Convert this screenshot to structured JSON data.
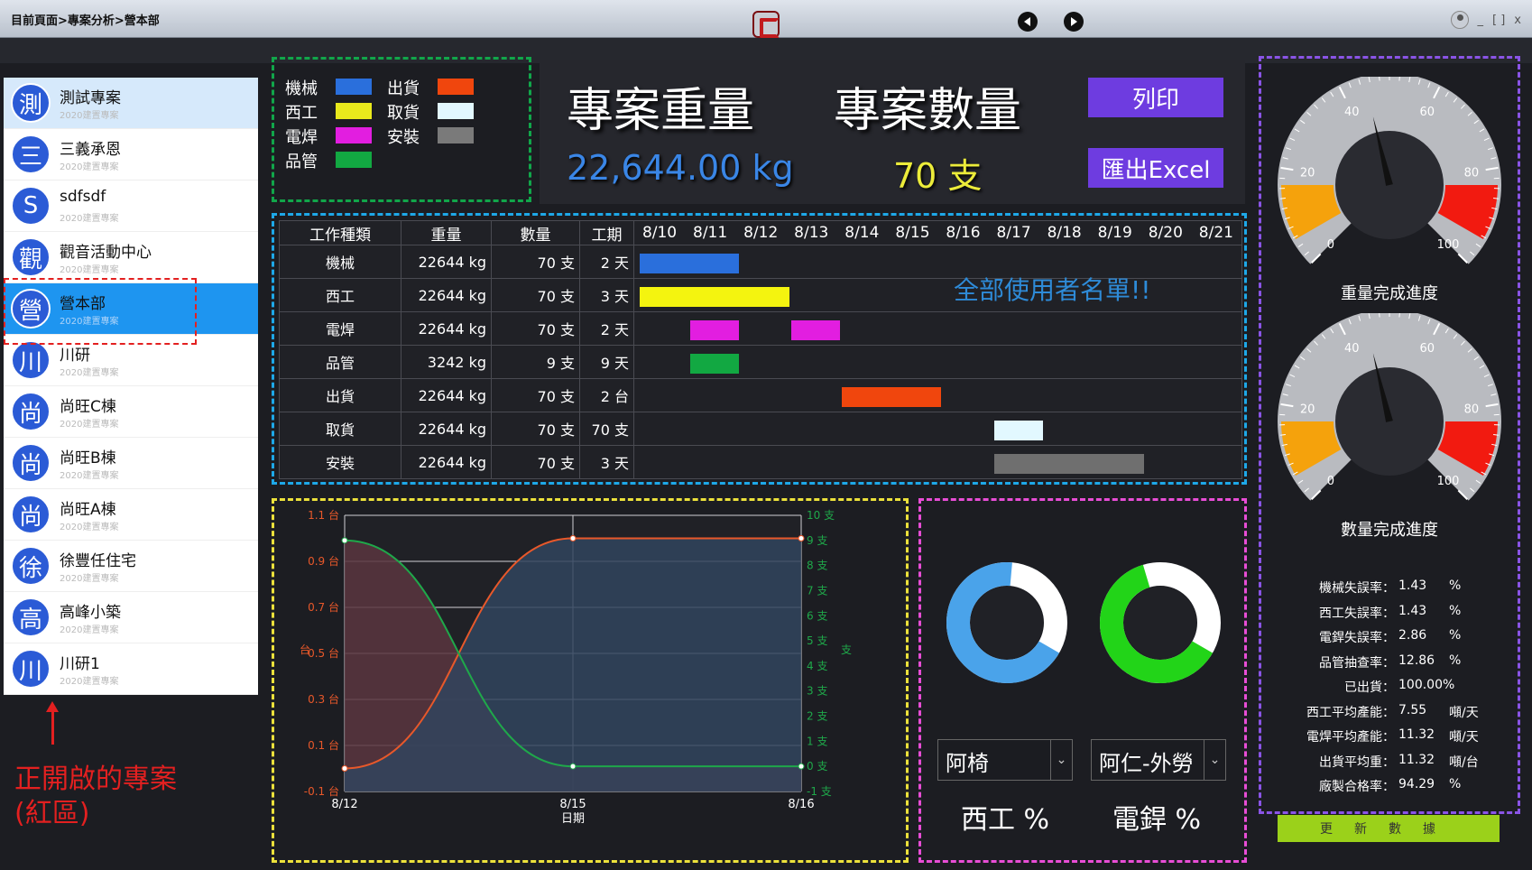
{
  "titlebar": {
    "breadcrumb": "目前頁面>專案分析>營本部"
  },
  "sidebar": {
    "projects": [
      {
        "avatar": "測",
        "name": "測試專案",
        "sub": "2020建置專案"
      },
      {
        "avatar": "三",
        "name": "三義承恩",
        "sub": "2020建置專案"
      },
      {
        "avatar": "S",
        "name": "sdfsdf",
        "sub": "2020建置專案"
      },
      {
        "avatar": "觀",
        "name": "觀音活動中心",
        "sub": "2020建置專案"
      },
      {
        "avatar": "營",
        "name": "營本部",
        "sub": "2020建置專案"
      },
      {
        "avatar": "川",
        "name": "川研",
        "sub": "2020建置專案"
      },
      {
        "avatar": "尚",
        "name": "尚旺C棟",
        "sub": "2020建置專案"
      },
      {
        "avatar": "尚",
        "name": "尚旺B棟",
        "sub": "2020建置專案"
      },
      {
        "avatar": "尚",
        "name": "尚旺A棟",
        "sub": "2020建置專案"
      },
      {
        "avatar": "徐",
        "name": "徐豐任住宅",
        "sub": "2020建置專案"
      },
      {
        "avatar": "高",
        "name": "高峰小築",
        "sub": "2020建置專案"
      },
      {
        "avatar": "川",
        "name": "川研1",
        "sub": "2020建置專案"
      }
    ],
    "annotation": "正開啟的專案\n(紅區)"
  },
  "legend": {
    "items": [
      {
        "label": "機械",
        "color": "#2a6fdc"
      },
      {
        "label": "西工",
        "color": "#e9e91c"
      },
      {
        "label": "電焊",
        "color": "#e21ee0"
      },
      {
        "label": "品管",
        "color": "#12a842"
      },
      {
        "label": "出貨",
        "color": "#f0460d"
      },
      {
        "label": "取貨",
        "color": "#e2f8ff"
      },
      {
        "label": "安裝",
        "color": "#7a7a7a"
      }
    ]
  },
  "summary": {
    "weight_title": "專案重量",
    "count_title": "專案數量",
    "weight_value": "22,644.00 kg",
    "count_value": "70 支",
    "print_label": "列印",
    "export_label": "匯出Excel"
  },
  "gantt": {
    "headers": [
      "工作種類",
      "重量",
      "數量",
      "工期"
    ],
    "dates": [
      "8/10",
      "8/11",
      "8/12",
      "8/13",
      "8/14",
      "8/15",
      "8/16",
      "8/17",
      "8/18",
      "8/19",
      "8/20",
      "8/21"
    ],
    "rows": [
      {
        "type": "機械",
        "weight": "22644 kg",
        "qty": "70 支",
        "period": "2 天",
        "color": "#2a6fdc",
        "bars": [
          [
            0,
            2
          ]
        ]
      },
      {
        "type": "西工",
        "weight": "22644 kg",
        "qty": "70 支",
        "period": "3 天",
        "color": "#f4f40f",
        "bars": [
          [
            0,
            3
          ]
        ]
      },
      {
        "type": "電焊",
        "weight": "22644 kg",
        "qty": "70 支",
        "period": "2 天",
        "color": "#e21ee0",
        "bars": [
          [
            1,
            1
          ],
          [
            3,
            1
          ]
        ]
      },
      {
        "type": "品管",
        "weight": "3242 kg",
        "qty": "9 支",
        "period": "9 天",
        "color": "#12a842",
        "bars": [
          [
            1,
            1
          ]
        ]
      },
      {
        "type": "出貨",
        "weight": "22644 kg",
        "qty": "70 支",
        "period": "2 台",
        "color": "#f0460d",
        "bars": [
          [
            4,
            2
          ]
        ]
      },
      {
        "type": "取貨",
        "weight": "22644 kg",
        "qty": "70 支",
        "period": "70 支",
        "color": "#e2f8ff",
        "bars": [
          [
            7,
            1
          ]
        ]
      },
      {
        "type": "安裝",
        "weight": "22644 kg",
        "qty": "70 支",
        "period": "3 天",
        "color": "#6f6f6f",
        "bars": [
          [
            7,
            3
          ]
        ]
      }
    ],
    "note": "全部使用者名單!!"
  },
  "chart_data": {
    "type": "area",
    "categories": [
      "8/12",
      "8/15",
      "8/16"
    ],
    "xlabel": "日期",
    "ylabel": "台",
    "ylabel_right": "支",
    "y_left": {
      "ticks": [
        "1.1 台",
        "0.9 台",
        "0.7 台",
        "0.5 台",
        "0.3 台",
        "0.1 台",
        "-0.1 台"
      ],
      "ylim": [
        -0.1,
        1.1
      ],
      "color": "#e8582a"
    },
    "y_right": {
      "ticks": [
        "10 支",
        "9 支",
        "8 支",
        "7 支",
        "6 支",
        "5 支",
        "4 支",
        "3 支",
        "2 支",
        "1 支",
        "0 支",
        "-1 支"
      ],
      "ylim": [
        -1,
        10
      ],
      "color": "#1fa84a"
    },
    "series": [
      {
        "axis": "left",
        "color": "#e8582a",
        "fill": "#31445e",
        "values": [
          0,
          1,
          1
        ]
      },
      {
        "axis": "right",
        "color": "#1fa84a",
        "fill": "#5a3540",
        "values": [
          9,
          0,
          0
        ]
      }
    ]
  },
  "donuts": {
    "left": {
      "value": 0.68,
      "color": "#4aa3ea",
      "select": "阿椅",
      "label": "西工 %"
    },
    "right": {
      "value": 0.62,
      "color": "#22d418",
      "select": "阿仁-外勞",
      "label": "電銲 %"
    }
  },
  "gauges": [
    {
      "caption": "重量完成進度",
      "value": 0.45,
      "ticks": [
        "0",
        "20",
        "40",
        "60",
        "80",
        "100"
      ]
    },
    {
      "caption": "數量完成進度",
      "value": 0.45,
      "ticks": [
        "0",
        "20",
        "40",
        "60",
        "80",
        "100"
      ]
    }
  ],
  "stats": [
    {
      "k": "機械失誤率：",
      "v": "1.43",
      "u": "%"
    },
    {
      "k": "西工失誤率：",
      "v": "1.43",
      "u": "%"
    },
    {
      "k": "電銲失誤率：",
      "v": "2.86",
      "u": "%"
    },
    {
      "k": "品管抽查率：",
      "v": "12.86",
      "u": "%"
    },
    {
      "k": "已出貨：",
      "v": "100.00%",
      "u": ""
    },
    {
      "k": "西工平均產能：",
      "v": "7.55",
      "u": "噸/天"
    },
    {
      "k": "電焊平均產能：",
      "v": "11.32",
      "u": "噸/天"
    },
    {
      "k": "出貨平均重：",
      "v": "11.32",
      "u": "噸/台"
    },
    {
      "k": "廠製合格率：",
      "v": "94.29",
      "u": "%"
    }
  ],
  "update_label": "更新數據"
}
